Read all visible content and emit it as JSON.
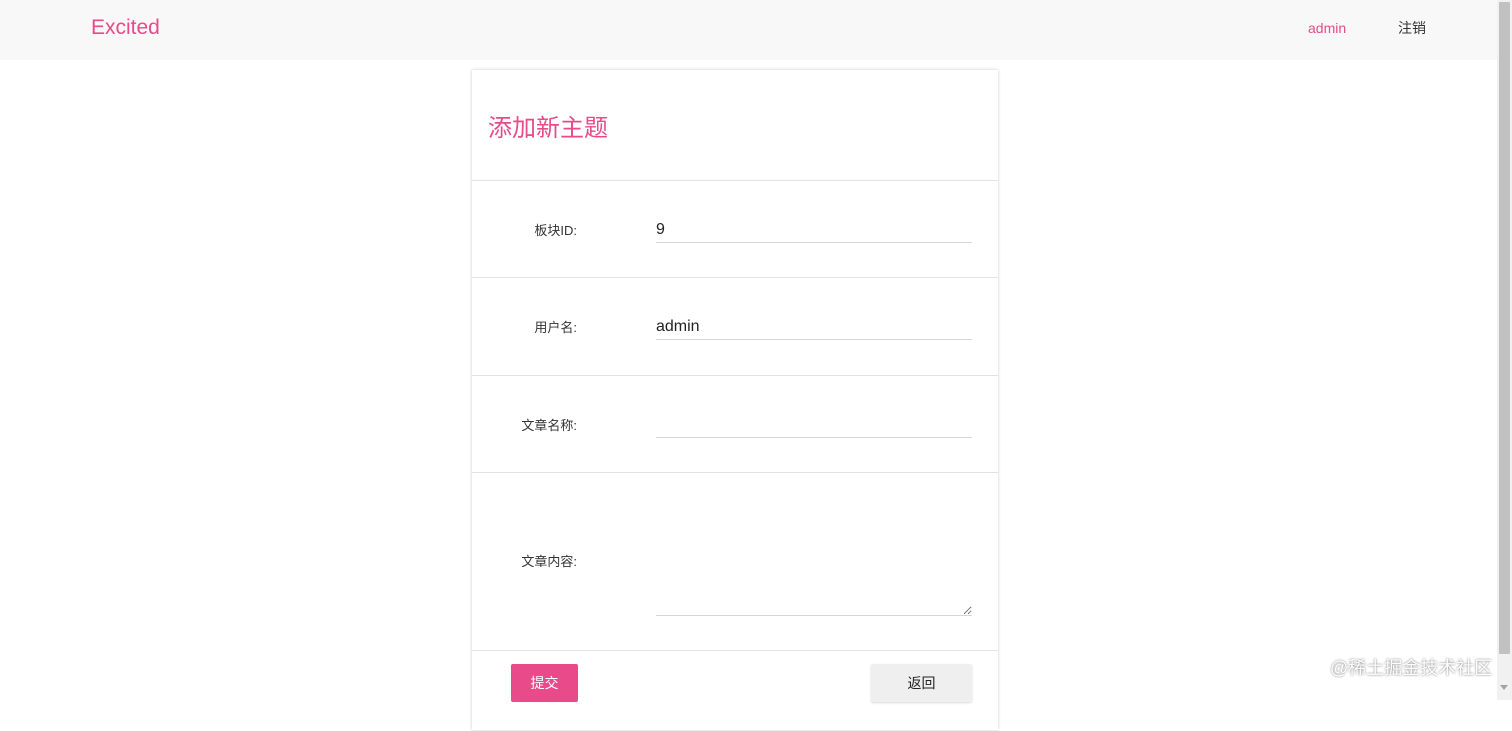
{
  "navbar": {
    "brand": "Excited",
    "user": "admin",
    "logout": "注销"
  },
  "form": {
    "title": "添加新主题",
    "fields": [
      {
        "label": "板块ID:",
        "value": ""
      },
      {
        "label": "用户名:",
        "value": ""
      },
      {
        "label": "文章名称:",
        "value": ""
      },
      {
        "label": "文章内容:",
        "value": ""
      }
    ],
    "values": {
      "board_id": "9",
      "username": "admin",
      "title": "",
      "content": ""
    },
    "submit_label": "提交",
    "back_label": "返回"
  },
  "watermark": "@稀土掘金技术社区",
  "colors": {
    "accent": "#e84a8a",
    "navbar_bg": "#f8f8f8",
    "back_button_bg": "#efefef"
  }
}
